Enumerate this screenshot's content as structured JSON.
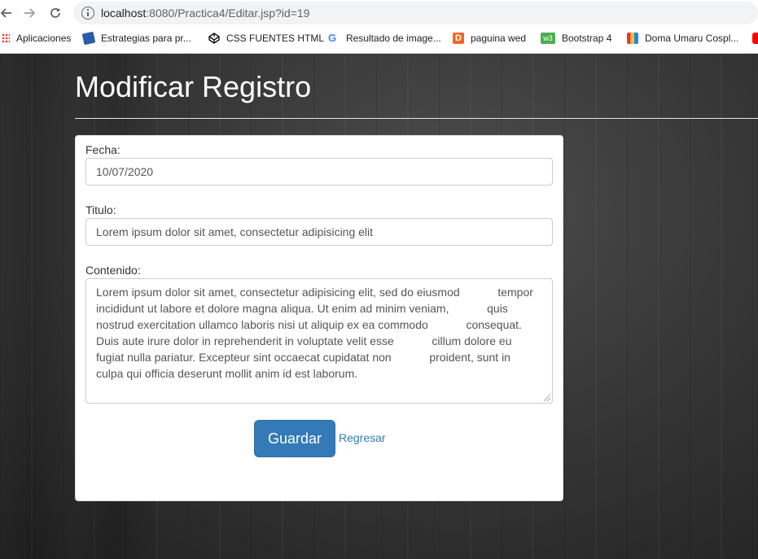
{
  "browser": {
    "url_host": "localhost",
    "url_path": ":8080/Practica4/Editar.jsp?id=19",
    "bookmarks": [
      {
        "label": "Aplicaciones",
        "icon": "apps-grid-icon"
      },
      {
        "label": "Estrategias para pr...",
        "icon": "bookmark-favicon-icon"
      },
      {
        "label": "CSS FUENTES HTML",
        "icon": "codepen-icon"
      },
      {
        "label": "Resultado de image...",
        "icon": "google-icon"
      },
      {
        "label": "paguina wed",
        "icon": "d-favicon-icon"
      },
      {
        "label": "Bootstrap 4",
        "icon": "w3-favicon-icon"
      },
      {
        "label": "Doma Umaru Cospl...",
        "icon": "shopping-bag-icon"
      }
    ]
  },
  "page": {
    "title": "Modificar Registro"
  },
  "form": {
    "fecha_label": "Fecha:",
    "fecha_value": "10/07/2020",
    "titulo_label": "Titulo:",
    "titulo_value": "Lorem ipsum dolor sit amet, consectetur adipisicing elit",
    "contenido_label": "Contenido:",
    "contenido_lines": [
      "Lorem ipsum dolor sit amet, consectetur adipisicing elit, sed do eiusmod            tempor",
      "incididunt ut labore et dolore magna aliqua. Ut enim ad minim veniam,            quis",
      "nostrud exercitation ullamco laboris nisi ut aliquip ex ea commodo            consequat.",
      "Duis aute irure dolor in reprehenderit in voluptate velit esse            cillum dolore eu",
      "fugiat nulla pariatur. Excepteur sint occaecat cupidatat non            proident, sunt in",
      "culpa qui officia deserunt mollit anim id est laborum."
    ],
    "save_label": "Guardar",
    "back_label": "Regresar"
  },
  "colors": {
    "primary": "#337ab7",
    "link": "#337ab7",
    "background": "#2b2b2b"
  }
}
